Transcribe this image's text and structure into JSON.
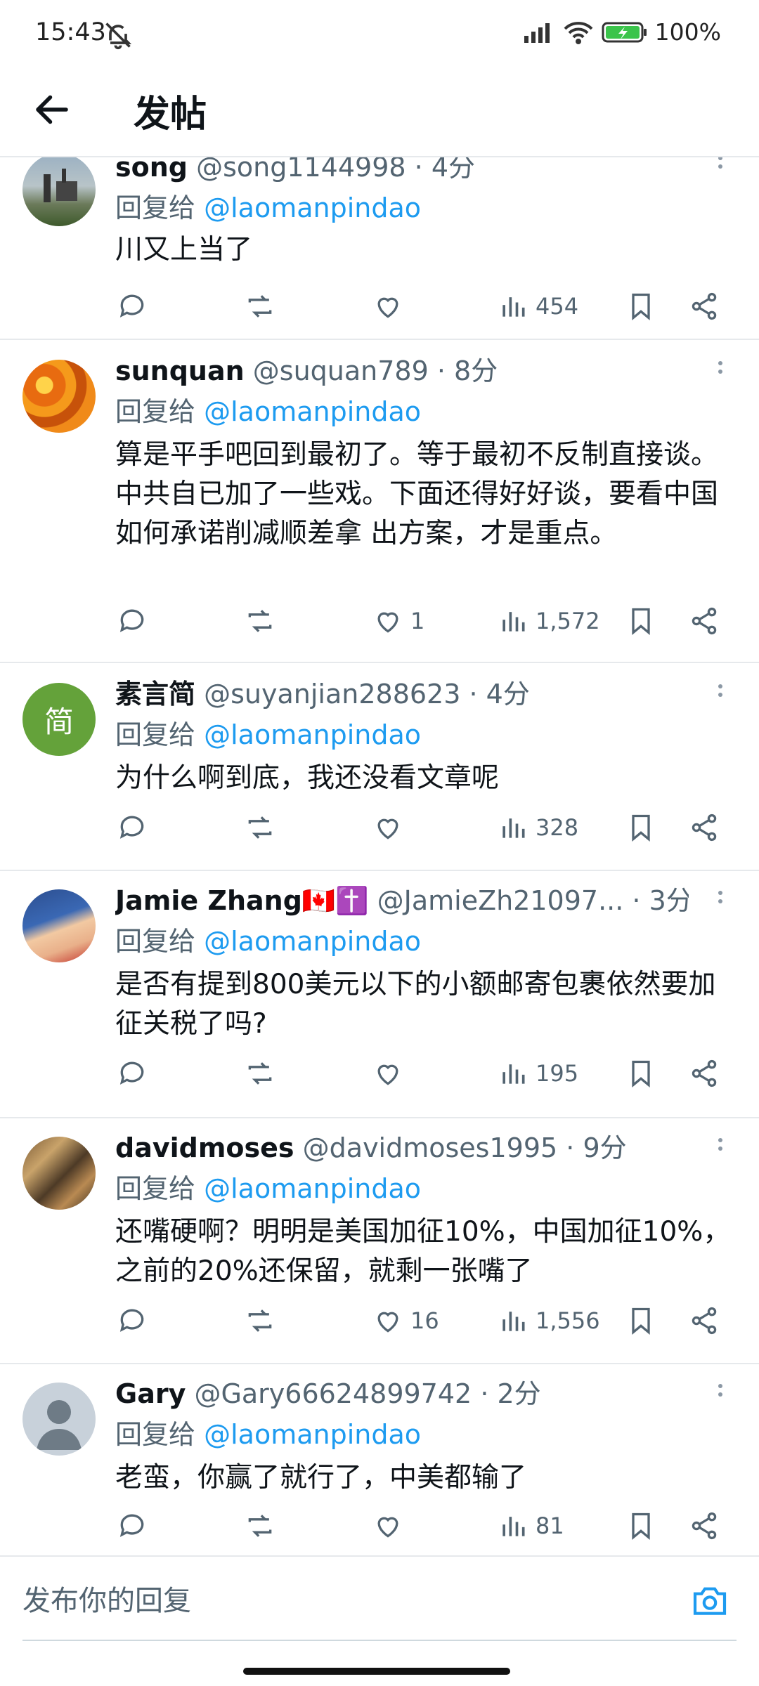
{
  "status_bar": {
    "time": "15:43",
    "battery": "100%"
  },
  "header": {
    "title": "发帖"
  },
  "reply_prefix": "回复给",
  "colors": {
    "accent": "#1d9bf0",
    "secondary_text": "#536471",
    "primary_text": "#0f1419"
  },
  "tweets": [
    {
      "name": "song",
      "handle": "@song1144998",
      "time": "· 4分",
      "reply_to": "@laomanpindao",
      "text": "川又上当了",
      "likes": "",
      "views": "454",
      "avatar": "factory-photo"
    },
    {
      "name": "sunquan",
      "handle": "@suquan789",
      "time": "· 8分",
      "reply_to": "@laomanpindao",
      "text": "算是平手吧回到最初了。等于最初不反制直接谈。中共自已加了一些戏。下面还得好好谈，要看中国如何承诺削减顺差拿 出方案，才是重点。",
      "likes": "1",
      "views": "1,572",
      "avatar": "orange-flowers"
    },
    {
      "name": "素言简",
      "handle": "@suyanjian288623",
      "time": "· 4分",
      "reply_to": "@laomanpindao",
      "text": "为什么啊到底，我还没看文章呢",
      "likes": "",
      "views": "328",
      "avatar": "简"
    },
    {
      "name": "Jamie Zhang🇨🇦✝️",
      "handle": "@JamieZh21097...",
      "time": "· 3分",
      "reply_to": "@laomanpindao",
      "text": "是否有提到800美元以下的小额邮寄包裹依然要加征关税了吗?",
      "likes": "",
      "views": "195",
      "avatar": "portrait"
    },
    {
      "name": "davidmoses",
      "handle": "@davidmoses1995",
      "time": "· 9分",
      "reply_to": "@laomanpindao",
      "text": "还嘴硬啊？明明是美国加征10%，中国加征10%，之前的20%还保留，就剩一张嘴了",
      "likes": "16",
      "views": "1,556",
      "avatar": "painting"
    },
    {
      "name": "Gary",
      "handle": "@Gary66624899742",
      "time": "· 2分",
      "reply_to": "@laomanpindao",
      "text": "老蛮，你赢了就行了，中美都输了",
      "likes": "",
      "views": "81",
      "avatar": "default-user"
    }
  ],
  "compose": {
    "placeholder": "发布你的回复"
  }
}
